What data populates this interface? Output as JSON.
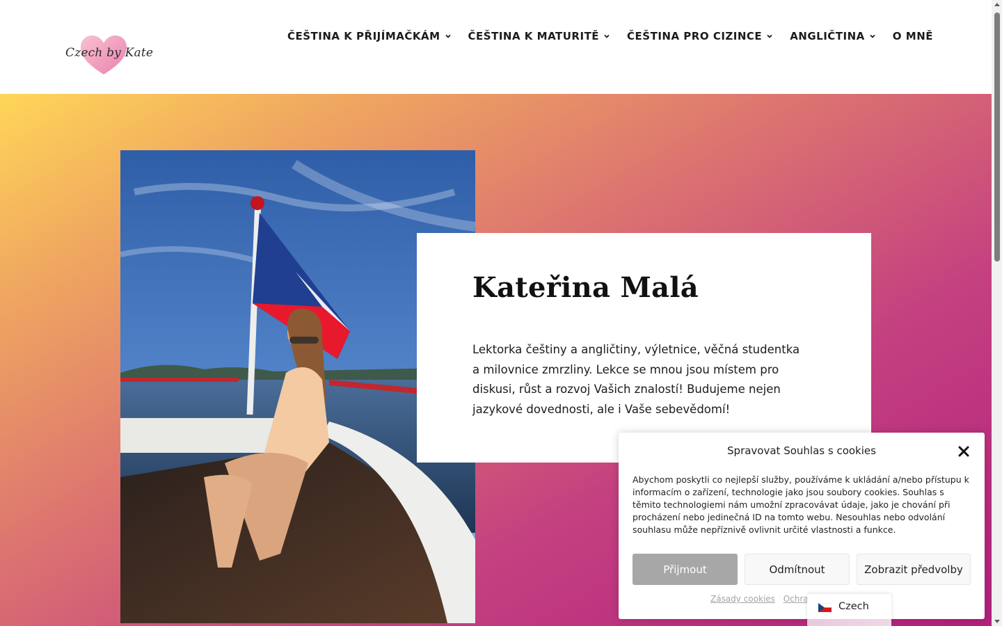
{
  "header": {
    "logo_text": "Czech by Kate",
    "nav": [
      {
        "label": "ČEŠTINA K PŘIJÍMAČKÁM",
        "has_dropdown": true
      },
      {
        "label": "ČEŠTINA K MATURITĚ",
        "has_dropdown": true
      },
      {
        "label": "ČEŠTINA PRO CIZINCE",
        "has_dropdown": true
      },
      {
        "label": "ANGLIČTINA",
        "has_dropdown": true
      },
      {
        "label": "O MNĚ",
        "has_dropdown": false
      }
    ]
  },
  "hero": {
    "gradient_colors": [
      "#ffd658",
      "#dc7470",
      "#b2207d"
    ],
    "card": {
      "title": "Kateřina Malá",
      "text": "Lektorka češtiny a angličtiny, výletnice, věčná studentka a milovnice zmrzliny. Lekce se mnou jsou místem pro diskusi, růst a rozvoj Vašich znalostí! Budujeme nejen jazykové dovednosti, ale i Vaše sebevědomí!"
    }
  },
  "cookie_dialog": {
    "title": "Spravovat Souhlas s cookies",
    "body": "Abychom poskytli co nejlepší služby, používáme k ukládání a/nebo přístupu k informacím o zařízení, technologie jako jsou soubory cookies. Souhlas s těmito technologiemi nám umožní zpracovávat údaje, jako je chování při procházení nebo jedinečná ID na tomto webu. Nesouhlas nebo odvolání souhlasu může nepříznivě ovlivnit určité vlastnosti a funkce.",
    "accept_label": "Přijmout",
    "deny_label": "Odmítnout",
    "prefs_label": "Zobrazit předvolby",
    "links": [
      "Zásady cookies",
      "Ochrana osobních údajů"
    ]
  },
  "language_switcher": {
    "label": "Czech",
    "flag": "czech-flag-icon"
  }
}
